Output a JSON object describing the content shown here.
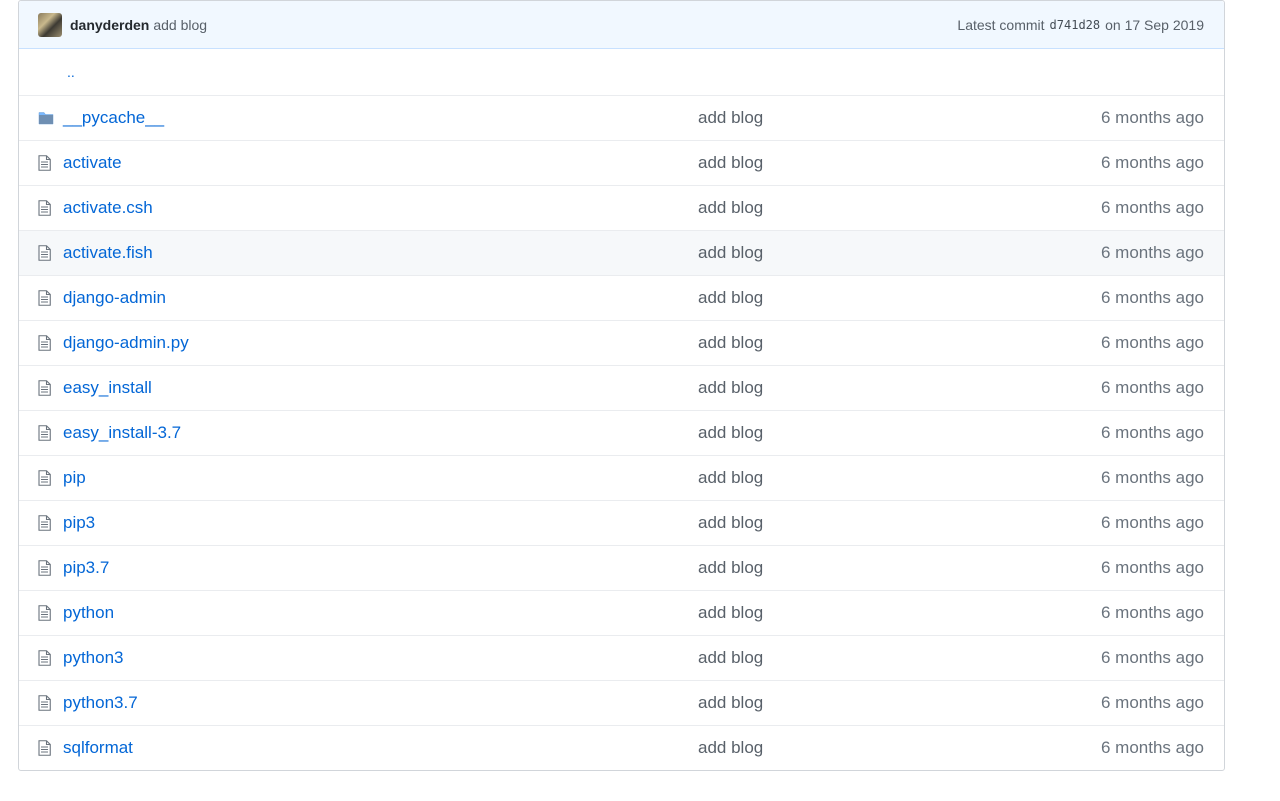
{
  "header": {
    "author": "danyderden",
    "commit_message": "add blog",
    "latest_commit_label": "Latest commit",
    "sha": "d741d28",
    "date": "on 17 Sep 2019"
  },
  "parent": {
    "label": ".."
  },
  "files": [
    {
      "name": "__pycache__",
      "type": "directory",
      "message": "add blog",
      "age": "6 months ago",
      "icon": "folder-icon"
    },
    {
      "name": "activate",
      "type": "file",
      "message": "add blog",
      "age": "6 months ago",
      "icon": "file-icon"
    },
    {
      "name": "activate.csh",
      "type": "file",
      "message": "add blog",
      "age": "6 months ago",
      "icon": "file-icon"
    },
    {
      "name": "activate.fish",
      "type": "file",
      "message": "add blog",
      "age": "6 months ago",
      "icon": "file-icon"
    },
    {
      "name": "django-admin",
      "type": "file",
      "message": "add blog",
      "age": "6 months ago",
      "icon": "file-icon"
    },
    {
      "name": "django-admin.py",
      "type": "file",
      "message": "add blog",
      "age": "6 months ago",
      "icon": "file-icon"
    },
    {
      "name": "easy_install",
      "type": "file",
      "message": "add blog",
      "age": "6 months ago",
      "icon": "file-icon"
    },
    {
      "name": "easy_install-3.7",
      "type": "file",
      "message": "add blog",
      "age": "6 months ago",
      "icon": "file-icon"
    },
    {
      "name": "pip",
      "type": "file",
      "message": "add blog",
      "age": "6 months ago",
      "icon": "file-icon"
    },
    {
      "name": "pip3",
      "type": "file",
      "message": "add blog",
      "age": "6 months ago",
      "icon": "file-icon"
    },
    {
      "name": "pip3.7",
      "type": "file",
      "message": "add blog",
      "age": "6 months ago",
      "icon": "file-icon"
    },
    {
      "name": "python",
      "type": "file",
      "message": "add blog",
      "age": "6 months ago",
      "icon": "file-icon"
    },
    {
      "name": "python3",
      "type": "file",
      "message": "add blog",
      "age": "6 months ago",
      "icon": "file-icon"
    },
    {
      "name": "python3.7",
      "type": "file",
      "message": "add blog",
      "age": "6 months ago",
      "icon": "file-icon"
    },
    {
      "name": "sqlformat",
      "type": "file",
      "message": "add blog",
      "age": "6 months ago",
      "icon": "file-icon"
    }
  ],
  "hovered_row": "activate.fish",
  "colors": {
    "link": "#0366d6",
    "header_bg": "#f1f8ff",
    "icon": "#6a737d",
    "folder": "#79b8ff"
  }
}
